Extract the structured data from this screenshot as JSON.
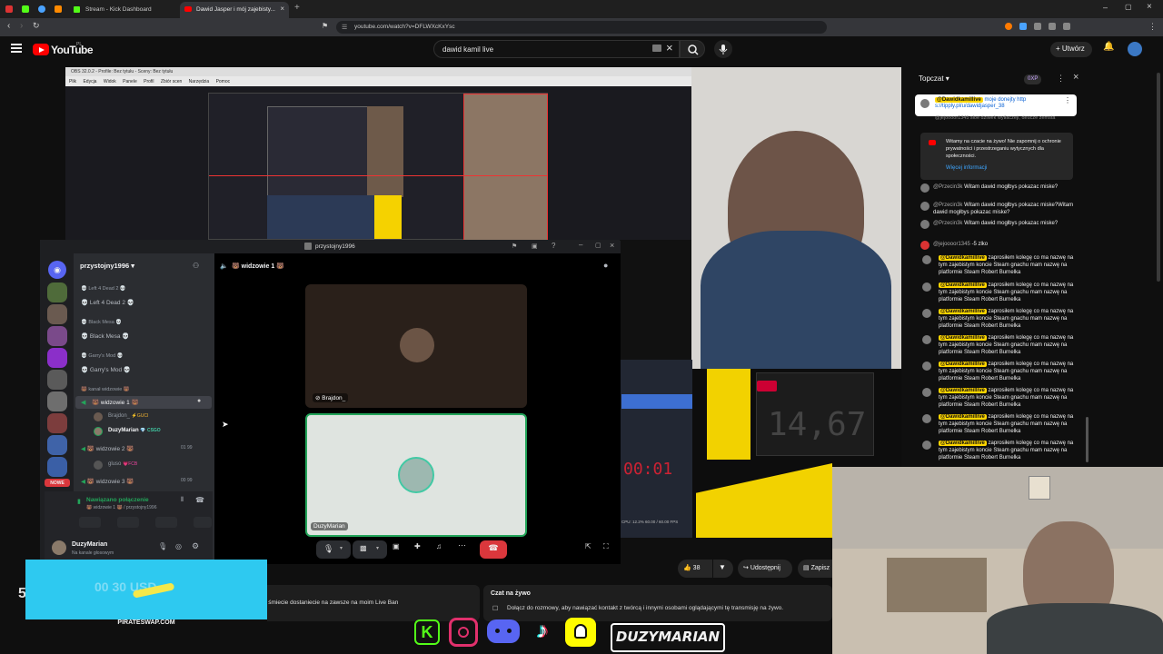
{
  "browser": {
    "tabs": [
      {
        "label": "Stream - Kick Dashboard",
        "active": false
      },
      {
        "label": "Dawid Jasper i mój zajebisty...",
        "active": true
      }
    ],
    "url": "youtube.com/watch?v=DFLWXcKxYsc"
  },
  "youtube": {
    "logo_text": "YouTube",
    "logo_region": "PL",
    "search_value": "dawid kamil live",
    "create_label": "Utwórz"
  },
  "obs": {
    "title": "OBS 32.0.2 - Profile: Bez tytułu - Sceny: Bez tytułu",
    "menu": [
      "Plik",
      "Edycja",
      "Widok",
      "Panele",
      "Profil",
      "Zbiór scen",
      "Narzędzia",
      "Pomoc"
    ],
    "status": "CPU: 12.2%   60.00 / 60.00 FPS"
  },
  "discord": {
    "window_title": "przystojny1996",
    "server_name": "przystojny1996",
    "voice_header": "🐻 widzowie 1 🐻",
    "channels": [
      {
        "category": "💀 Left 4 Dead 2 💀",
        "name": "💀 Left 4 Dead 2 💀"
      },
      {
        "category": "💀 Black Mesa 💀",
        "name": "💀 Black Mesa 💀"
      },
      {
        "category": "💀 Garry's Mod 💀",
        "name": "💀 Garry's Mod 💀"
      }
    ],
    "voice_category": "🐻 kanał widzowie 🐻",
    "voice_channels": [
      {
        "name": "🐻 widzowie 1 🐻",
        "count": ""
      },
      {
        "name": "🐻 widzowie 2 🐻",
        "count": "01  99"
      },
      {
        "name": "🐻 widzowie 3 🐻",
        "count": "00  99"
      }
    ],
    "members_ch1": [
      {
        "name": "Brajdon_",
        "badge": "⚡GUCI"
      },
      {
        "name": "DuzyMarian",
        "badge": "💎 CSGO"
      }
    ],
    "members_ch2": [
      {
        "name": "gluso",
        "badge": "💗FCB"
      }
    ],
    "new_badge": "NOWE",
    "connected_text": "Nawiązano połączenie",
    "connected_sub": "🐻 widzowie 1 🐻 / przystojny1996",
    "user_name": "DuzyMarian",
    "user_status": "Na kanale głosowym",
    "tile1_name": "Brajdon_",
    "tile2_name": "DuzyMarian"
  },
  "chat": {
    "header": "Topczat",
    "points": "0XP",
    "pinned_author": "@Dawidkamillive",
    "pinned_text": "moje donejty http s://tipply.pl/u/dawidjasper_38",
    "partial_text": "@jejoooor1345  słoe dziwek wytłaczeji, deucze zemsta",
    "notice": "Witamy na czacie na żywo! Nie zapomnij o ochronie prywatności i przestrzeganiu wytycznych dla społeczności.",
    "notice_link": "Więcej informacji",
    "messages": [
      {
        "author": "@Przecin3k",
        "text": "Witam dawid mogłbys pokazac miske?",
        "hl": false
      },
      {
        "author": "@Przecin3k",
        "text": "Witam dawid mogłbys pokazac miske?Witam dawid mogłbys pokazac miske?",
        "hl": false
      },
      {
        "author": "@Przecin3k",
        "text": "Witam dawid mogłbys pokazac miske?",
        "hl": false
      },
      {
        "author": "@jejoooor1345",
        "text": "-5 zlko",
        "hl": false
      },
      {
        "author": "@Dawidkamillive",
        "text": "zaprosiłem kolegę co ma nazwę na tym zajebistym koncie Steam gnachu mam nazwę na platformie Steam Robert Burnelka",
        "hl": true
      },
      {
        "author": "@Dawidkamillive",
        "text": "zaprosiłem kolegę co ma nazwę na tym zajebistym koncie Steam gnachu mam nazwę na platformie Steam Robert Burnelka",
        "hl": true
      },
      {
        "author": "@Dawidkamillive",
        "text": "zaprosiłem kolegę co ma nazwę na tym zajebistym koncie Steam gnachu mam nazwę na platformie Steam Robert Burnelka",
        "hl": true
      },
      {
        "author": "@Dawidkamillive",
        "text": "zaprosiłem kolegę co ma nazwę na tym zajebistym koncie Steam gnachu mam nazwę na platformie Steam Robert Burnelka",
        "hl": true
      },
      {
        "author": "@Dawidkamillive",
        "text": "zaprosiłem kolegę co ma nazwę na tym zajebistym koncie Steam gnachu mam nazwę na platformie Steam Robert Burnelka",
        "hl": true
      },
      {
        "author": "@Dawidkamillive",
        "text": "zaprosiłem kolegę co ma nazwę na tym zajebistym koncie Steam gnachu mam nazwę na platformie Steam Robert Burnelka",
        "hl": true
      },
      {
        "author": "@Dawidkamillive",
        "text": "zaprosiłem kolegę co ma nazwę na tym zajebistym koncie Steam gnachu mam nazwę na platformie Steam Robert Burnelka",
        "hl": true
      },
      {
        "author": "@Dawidkamillive",
        "text": "zaprosiłem kolegę co ma nazwę na tym zajebistym koncie Steam gnachu mam nazwę na platformie Steam Robert Burnelka",
        "hl": true
      }
    ]
  },
  "video_actions": {
    "likes": "38",
    "share": "Udostępnij",
    "save": "Zapisz"
  },
  "below_video": {
    "ticker": "i śmiecie dostaniecie na zawsze na moim Live Ban",
    "live_chat_title": "Czat na żywo",
    "live_chat_text": "Dołącz do rozmowy, aby nawiązać kontakt z twórcą i innymi osobami oglądającymi tę transmisję na żywo."
  },
  "overlay": {
    "counter_text": "14,67",
    "timer_text": "00:01",
    "ad_brand": "PIRATESWAP.COM",
    "ad_faded": "00 30 USD",
    "streamer_name": "DUZYMARIAN",
    "left_digit": "5",
    "social_icons": [
      "kick-icon",
      "instagram-icon",
      "discord-icon",
      "tiktok-icon",
      "snapchat-icon"
    ]
  },
  "colors": {
    "youtube_red": "#ff0000",
    "kick_green": "#53fc18",
    "discord_blurple": "#5865f2",
    "highlight_yellow": "#ffd600",
    "end_call_red": "#da373c"
  }
}
